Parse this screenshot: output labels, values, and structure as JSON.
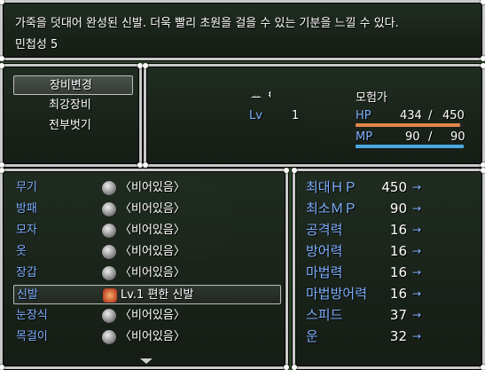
{
  "help": {
    "line1": "가죽을 덧대어 완성된 신발. 더욱 빨리 초원을 걸을 수 있는 기분을 느낄 수 있다.",
    "line2": "민첩성 5"
  },
  "commands": [
    "장비변경",
    "최강장비",
    "전부벗기"
  ],
  "actor": {
    "name": "ᅭᅧ",
    "lv_label": "Lv",
    "level": "1",
    "class": "모험가",
    "hp_label": "HP",
    "hp": "434",
    "hp_max": "450",
    "mp_label": "MP",
    "mp": "90",
    "mp_max": "90",
    "hp_fill": 0.964,
    "mp_fill": 1.0,
    "hp_color": "#e0874a",
    "mp_color": "#4aa8e0"
  },
  "equipment": [
    {
      "slot": "무기",
      "item": "〈비어있음〉",
      "icon": "empty-orb-icon"
    },
    {
      "slot": "방패",
      "item": "〈비어있음〉",
      "icon": "empty-orb-icon"
    },
    {
      "slot": "모자",
      "item": "〈비어있음〉",
      "icon": "empty-orb-icon"
    },
    {
      "slot": "옷",
      "item": "〈비어있음〉",
      "icon": "empty-orb-icon"
    },
    {
      "slot": "장갑",
      "item": "〈비어있음〉",
      "icon": "empty-orb-icon"
    },
    {
      "slot": "신발",
      "item": "Lv.1 편한 신발",
      "icon": "shoe-icon"
    },
    {
      "slot": "눈장식",
      "item": "〈비어있음〉",
      "icon": "empty-orb-icon"
    },
    {
      "slot": "목걸이",
      "item": "〈비어있음〉",
      "icon": "empty-orb-icon"
    }
  ],
  "params": [
    {
      "name": "최대ＨＰ",
      "value": "450"
    },
    {
      "name": "최소ＭＰ",
      "value": "90"
    },
    {
      "name": "공격력",
      "value": "16"
    },
    {
      "name": "방어력",
      "value": "16"
    },
    {
      "name": "마법력",
      "value": "16"
    },
    {
      "name": "마법방어력",
      "value": "16"
    },
    {
      "name": "스피드",
      "value": "37"
    },
    {
      "name": "운",
      "value": "32"
    }
  ],
  "arrow_glyph": "→"
}
